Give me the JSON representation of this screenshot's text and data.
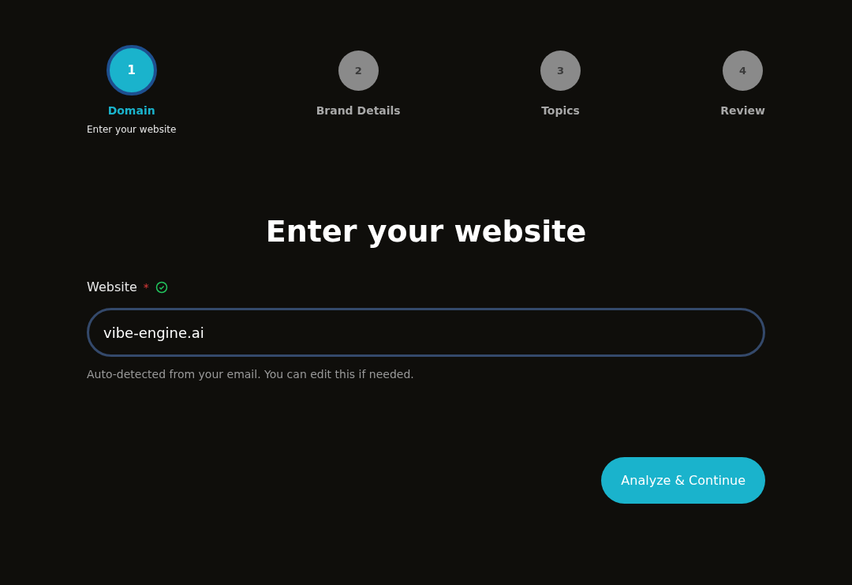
{
  "steps": [
    {
      "number": "1",
      "label": "Domain",
      "description": "Enter your website",
      "selected": true
    },
    {
      "number": "2",
      "label": "Brand Details",
      "selected": false
    },
    {
      "number": "3",
      "label": "Topics",
      "selected": false
    },
    {
      "number": "4",
      "label": "Review",
      "selected": false
    }
  ],
  "heading": "Enter your website",
  "field": {
    "label": "Website",
    "required_mark": "*",
    "valid": true,
    "value": "vibe-engine.ai",
    "focused": true,
    "hint": "Auto-detected from your email. You can edit this if needed."
  },
  "submit_button": "Analyze & Continue"
}
